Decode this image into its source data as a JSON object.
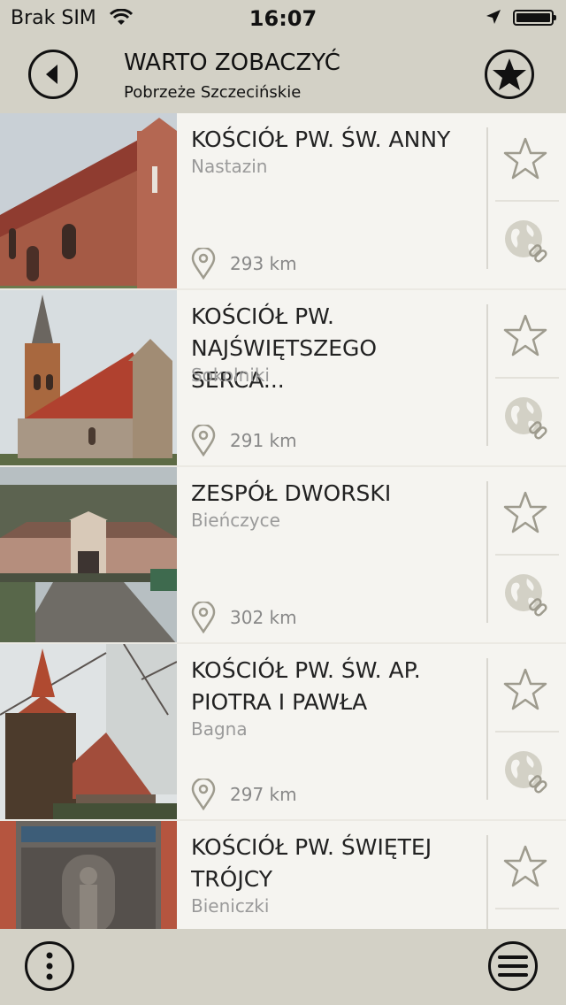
{
  "status_bar": {
    "carrier": "Brak SIM",
    "time": "16:07"
  },
  "header": {
    "title": "WARTO ZOBACZYĆ",
    "subtitle": "Pobrzeże Szczecińskie"
  },
  "items": [
    {
      "name": "KOŚCIÓŁ PW. ŚW. ANNY",
      "town": "Nastazin",
      "distance": "293 km"
    },
    {
      "name": "KOŚCIÓŁ PW. NAJŚWIĘTSZEGO SERCA...",
      "town": "Sokolniki",
      "distance": "291 km"
    },
    {
      "name": "ZESPÓŁ DWORSKI",
      "town": "Bieńczyce",
      "distance": "302 km"
    },
    {
      "name": "KOŚCIÓŁ PW. ŚW. AP. PIOTRA I PAWŁA",
      "town": "Bagna",
      "distance": "297 km"
    },
    {
      "name": "KOŚCIÓŁ PW. ŚWIĘTEJ TRÓJCY",
      "town": "Bieniczki",
      "distance": ""
    }
  ],
  "colors": {
    "bar_background": "#d3d1c6",
    "list_background": "#f5f4f0",
    "icon_grey": "#9e9b8e"
  },
  "icons": [
    "back-icon",
    "star-icon",
    "location-pin-icon",
    "globe-link-icon",
    "more-icon",
    "menu-icon"
  ]
}
